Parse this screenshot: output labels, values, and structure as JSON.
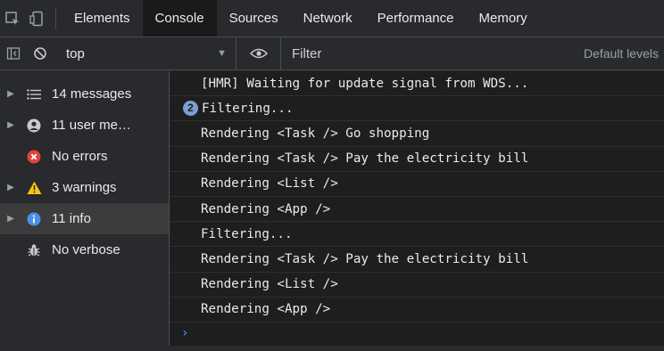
{
  "tabbar": {
    "tabs": [
      {
        "label": "Elements"
      },
      {
        "label": "Console",
        "active": true
      },
      {
        "label": "Sources"
      },
      {
        "label": "Network"
      },
      {
        "label": "Performance"
      },
      {
        "label": "Memory"
      }
    ]
  },
  "toolbar": {
    "context": "top",
    "filter_placeholder": "Filter",
    "levels": "Default levels"
  },
  "sidebar": {
    "items": [
      {
        "label": "14 messages",
        "icon": "list-icon",
        "expandable": true
      },
      {
        "label": "11 user me…",
        "icon": "user-icon",
        "expandable": true
      },
      {
        "label": "No errors",
        "icon": "error-icon",
        "expandable": false
      },
      {
        "label": "3 warnings",
        "icon": "warning-icon",
        "expandable": true
      },
      {
        "label": "11 info",
        "icon": "info-icon",
        "expandable": true,
        "selected": true
      },
      {
        "label": "No verbose",
        "icon": "bug-icon",
        "expandable": false
      }
    ]
  },
  "console": {
    "messages": [
      {
        "text": "[HMR] Waiting for update signal from WDS..."
      },
      {
        "text": "Filtering...",
        "repeat": "2"
      },
      {
        "text": "Rendering <Task /> Go shopping"
      },
      {
        "text": "Rendering <Task /> Pay the electricity bill"
      },
      {
        "text": "Rendering <List />"
      },
      {
        "text": "Rendering <App />"
      },
      {
        "text": "Filtering..."
      },
      {
        "text": "Rendering <Task /> Pay the electricity bill"
      },
      {
        "text": "Rendering <List />"
      },
      {
        "text": "Rendering <App />"
      }
    ],
    "prompt": "›"
  },
  "colors": {
    "panel": "#292a2d",
    "console_bg": "#1e1e1e",
    "selected": "#3c3c3c",
    "info": "#4d8fe8",
    "error": "#e0443b",
    "warning": "#f5c518",
    "prompt": "#4d9fef"
  }
}
